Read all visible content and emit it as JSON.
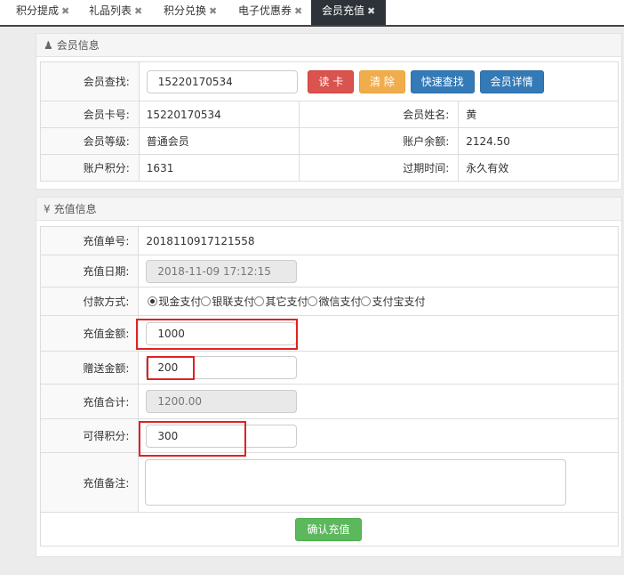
{
  "tabs": [
    {
      "label": "积分提成"
    },
    {
      "label": "礼品列表"
    },
    {
      "label": "积分兑换"
    },
    {
      "label": "电子优惠券"
    },
    {
      "label": "会员充值"
    }
  ],
  "close_glyph": "✖",
  "member": {
    "title": "会员信息",
    "icon": "user-icon",
    "search_label": "会员查找:",
    "search_value": "15220170534",
    "buttons": {
      "read_card": "读 卡",
      "clear": "清 除",
      "quick_search": "快速查找",
      "details": "会员详情"
    },
    "card_no_label": "会员卡号:",
    "card_no": "15220170534",
    "name_label": "会员姓名:",
    "name": "黄",
    "level_label": "会员等级:",
    "level": "普通会员",
    "balance_label": "账户余额:",
    "balance": "2124.50",
    "points_label": "账户积分:",
    "points": "1631",
    "expire_label": "过期时间:",
    "expire": "永久有效"
  },
  "recharge": {
    "title": "充值信息",
    "icon": "yen-icon",
    "order_label": "充值单号:",
    "order_no": "2018110917121558",
    "date_label": "充值日期:",
    "date": "2018-11-09 17:12:15",
    "pay_label": "付款方式:",
    "pay_options": [
      "现金支付",
      "银联支付",
      "其它支付",
      "微信支付",
      "支付宝支付"
    ],
    "amount_label": "充值金额:",
    "amount": "1000",
    "gift_label": "赠送金额:",
    "gift": "200",
    "total_label": "充值合计:",
    "total": "1200.00",
    "earn_label": "可得积分:",
    "earn": "300",
    "remark_label": "充值备注:",
    "confirm": "确认充值"
  },
  "colors": {
    "highlight": "#e02222",
    "tab_active": "#2d3338"
  }
}
